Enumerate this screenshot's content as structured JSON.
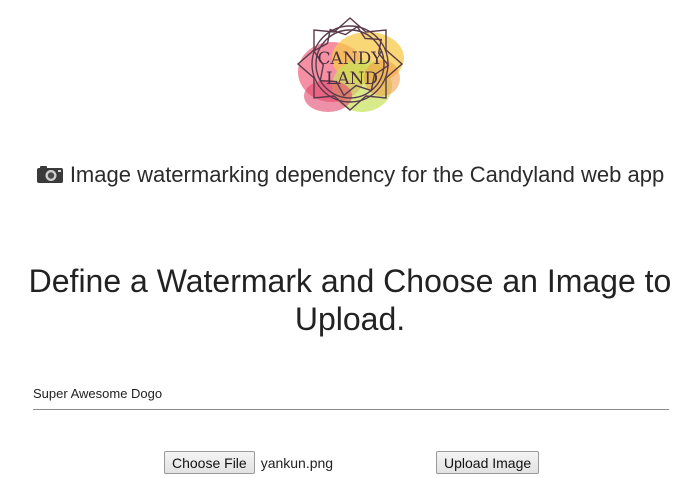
{
  "logo": {
    "line1": "CANDY",
    "line2": "LAND"
  },
  "header": {
    "camera_icon": "camera-icon",
    "subtitle": "Image watermarking dependency for the Candyland web app",
    "headline": "Define a Watermark and Choose an Image to Upload."
  },
  "form": {
    "watermark_value": "Super Awesome Dogo",
    "choose_file_label": "Choose File",
    "file_name": "yankun.png",
    "upload_label": "Upload Image"
  }
}
